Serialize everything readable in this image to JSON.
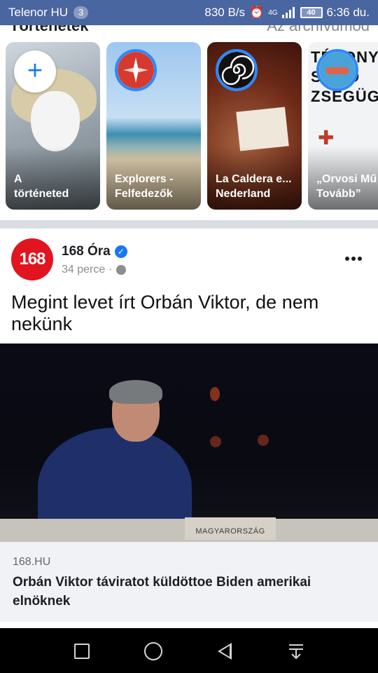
{
  "status_bar": {
    "carrier": "Telenor HU",
    "notification_count": "3",
    "data_speed": "830 B/s",
    "network_type": "4G",
    "battery": "40",
    "time": "6:36 du."
  },
  "stories": {
    "header_title": "Történetek",
    "archive_link": "Az archívumod",
    "items": [
      {
        "label": "A\ntörténeted",
        "icon": "plus-icon"
      },
      {
        "label": "Explorers -\nFelfedezők",
        "icon": "compass-logo"
      },
      {
        "label": "La Caldera e...\nNederland",
        "icon": "spiral-logo"
      },
      {
        "label": "„Orvosi Mű\nTovább”",
        "icon": "medical-logo"
      }
    ],
    "story3_text": "TÉNONY\nSZ  AD\nZSEGÜGY"
  },
  "post": {
    "page_name": "168 Óra",
    "avatar_text": "168",
    "time_ago": "34 perce",
    "separator": "·",
    "text": "Megint levet írt Orbán Viktor, de nem nekünk",
    "image_plaque": "MAGYARORSZÁG",
    "link_domain": "168.HU",
    "link_title": "Orbán Viktor táviratot küldöttoe Biden amerikai elnöknek"
  },
  "colors": {
    "status_bar": "#4A66A0",
    "accent": "#1877F2",
    "avatar_red": "#E1141F"
  }
}
